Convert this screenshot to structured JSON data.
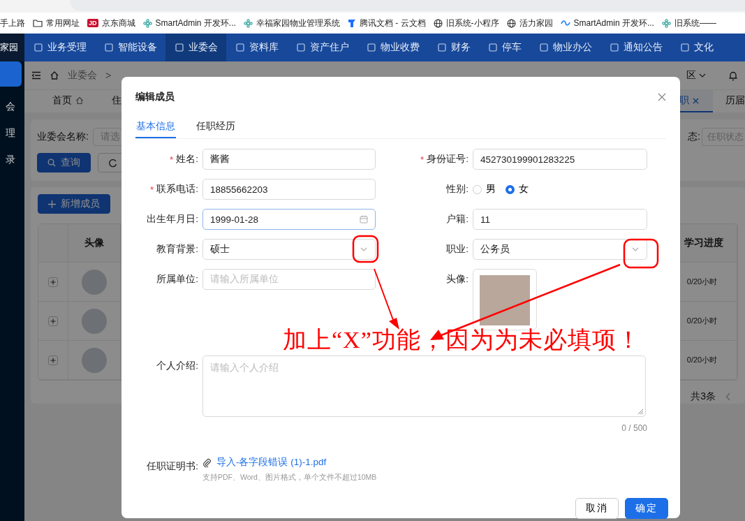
{
  "browser": {
    "bookmarks": [
      {
        "kind": "none",
        "label": "手上路"
      },
      {
        "kind": "folder",
        "label": "常用网址"
      },
      {
        "kind": "badge",
        "badge": "JD",
        "label": "京东商城"
      },
      {
        "kind": "flower",
        "label": "SmartAdmin 开发环..."
      },
      {
        "kind": "flower",
        "label": "幸福家园物业管理系统"
      },
      {
        "kind": "doc",
        "label": "腾讯文档 - 云文档"
      },
      {
        "kind": "globe",
        "label": "旧系统-小程序"
      },
      {
        "kind": "globe",
        "label": "活力家园"
      },
      {
        "kind": "link",
        "label": "SmartAdmin 开发环..."
      },
      {
        "kind": "flower",
        "label": "旧系统——"
      }
    ]
  },
  "top_nav": {
    "logo": "家园",
    "items": [
      {
        "label": "业务受理",
        "selected": false
      },
      {
        "label": "智能设备",
        "selected": false
      },
      {
        "label": "业委会",
        "selected": true
      },
      {
        "label": "资料库",
        "selected": false
      },
      {
        "label": "资产住户",
        "selected": false
      },
      {
        "label": "物业收费",
        "selected": false
      },
      {
        "label": "财务",
        "selected": false
      },
      {
        "label": "停车",
        "selected": false
      },
      {
        "label": "物业办公",
        "selected": false
      },
      {
        "label": "通知公告",
        "selected": false
      },
      {
        "label": "文化",
        "selected": false
      }
    ]
  },
  "sidebar": {
    "items": [
      {
        "label": "会",
        "selected": false
      },
      {
        "label": "理",
        "selected": false
      },
      {
        "label": "录",
        "selected": false
      }
    ]
  },
  "header": {
    "breadcrumb": [
      "业委会"
    ],
    "separator": ">",
    "community": "区"
  },
  "page_tabs": [
    {
      "label": "首页",
      "home": true,
      "selected": false,
      "closable": false
    },
    {
      "label": "住",
      "home": false,
      "selected": false,
      "closable": false
    },
    {
      "label": "职",
      "home": false,
      "selected": true,
      "closable": true
    },
    {
      "label": "历届",
      "home": false,
      "selected": false,
      "closable": false
    }
  ],
  "filters": {
    "left": {
      "label": "业委会名称:",
      "placeholder": "请选"
    },
    "right": {
      "label": "态:",
      "placeholder": "任职状态"
    },
    "search_button": "查询"
  },
  "add_button": "新增成员",
  "table": {
    "columns": [
      "头像",
      "学习进度"
    ],
    "rows": [
      {
        "progress": "0/20小时"
      },
      {
        "progress": "0/20小时"
      },
      {
        "progress": "0/20小时"
      }
    ],
    "total": "共3条"
  },
  "modal": {
    "title": "编辑成员",
    "tabs": [
      {
        "label": "基本信息",
        "selected": true
      },
      {
        "label": "任职经历",
        "selected": false
      }
    ],
    "fields": [
      {
        "kind": "text",
        "label": "姓名:",
        "required": true,
        "value": "酱酱"
      },
      {
        "kind": "text",
        "label": "身份证号:",
        "required": true,
        "value": "452730199901283225"
      },
      {
        "kind": "text",
        "label": "联系电话:",
        "required": true,
        "value": "18855662203"
      },
      {
        "kind": "radio",
        "label": "性别:",
        "required": false,
        "options": [
          {
            "label": "男",
            "selected": false
          },
          {
            "label": "女",
            "selected": true
          }
        ]
      },
      {
        "kind": "date",
        "label": "出生年月日:",
        "required": false,
        "value": "1999-01-28",
        "focused": true
      },
      {
        "kind": "text",
        "label": "户籍:",
        "required": false,
        "value": "11"
      },
      {
        "kind": "select",
        "label": "教育背景:",
        "required": false,
        "value": "硕士"
      },
      {
        "kind": "select",
        "label": "职业:",
        "required": false,
        "value": "公务员"
      },
      {
        "kind": "text",
        "label": "所属单位:",
        "required": false,
        "placeholder": "请输入所属单位"
      },
      {
        "kind": "image",
        "label": "头像:",
        "required": false
      },
      {
        "kind": "textarea",
        "label": "个人介绍:",
        "required": false,
        "placeholder": "请输入个人介绍",
        "counter": "0 / 500"
      },
      {
        "kind": "upload",
        "label": "任职证明书:",
        "required": false,
        "file": "导入-各字段错误 (1)-1.pdf",
        "hint": "支持PDF、Word、图片格式，单个文件不超过10MB"
      }
    ],
    "required_mark": "*",
    "buttons": [
      {
        "label": "取消",
        "primary": false
      },
      {
        "label": "确定",
        "primary": true
      }
    ]
  },
  "annotation": {
    "text": "加上“X”功能，因为为未必填项！"
  }
}
